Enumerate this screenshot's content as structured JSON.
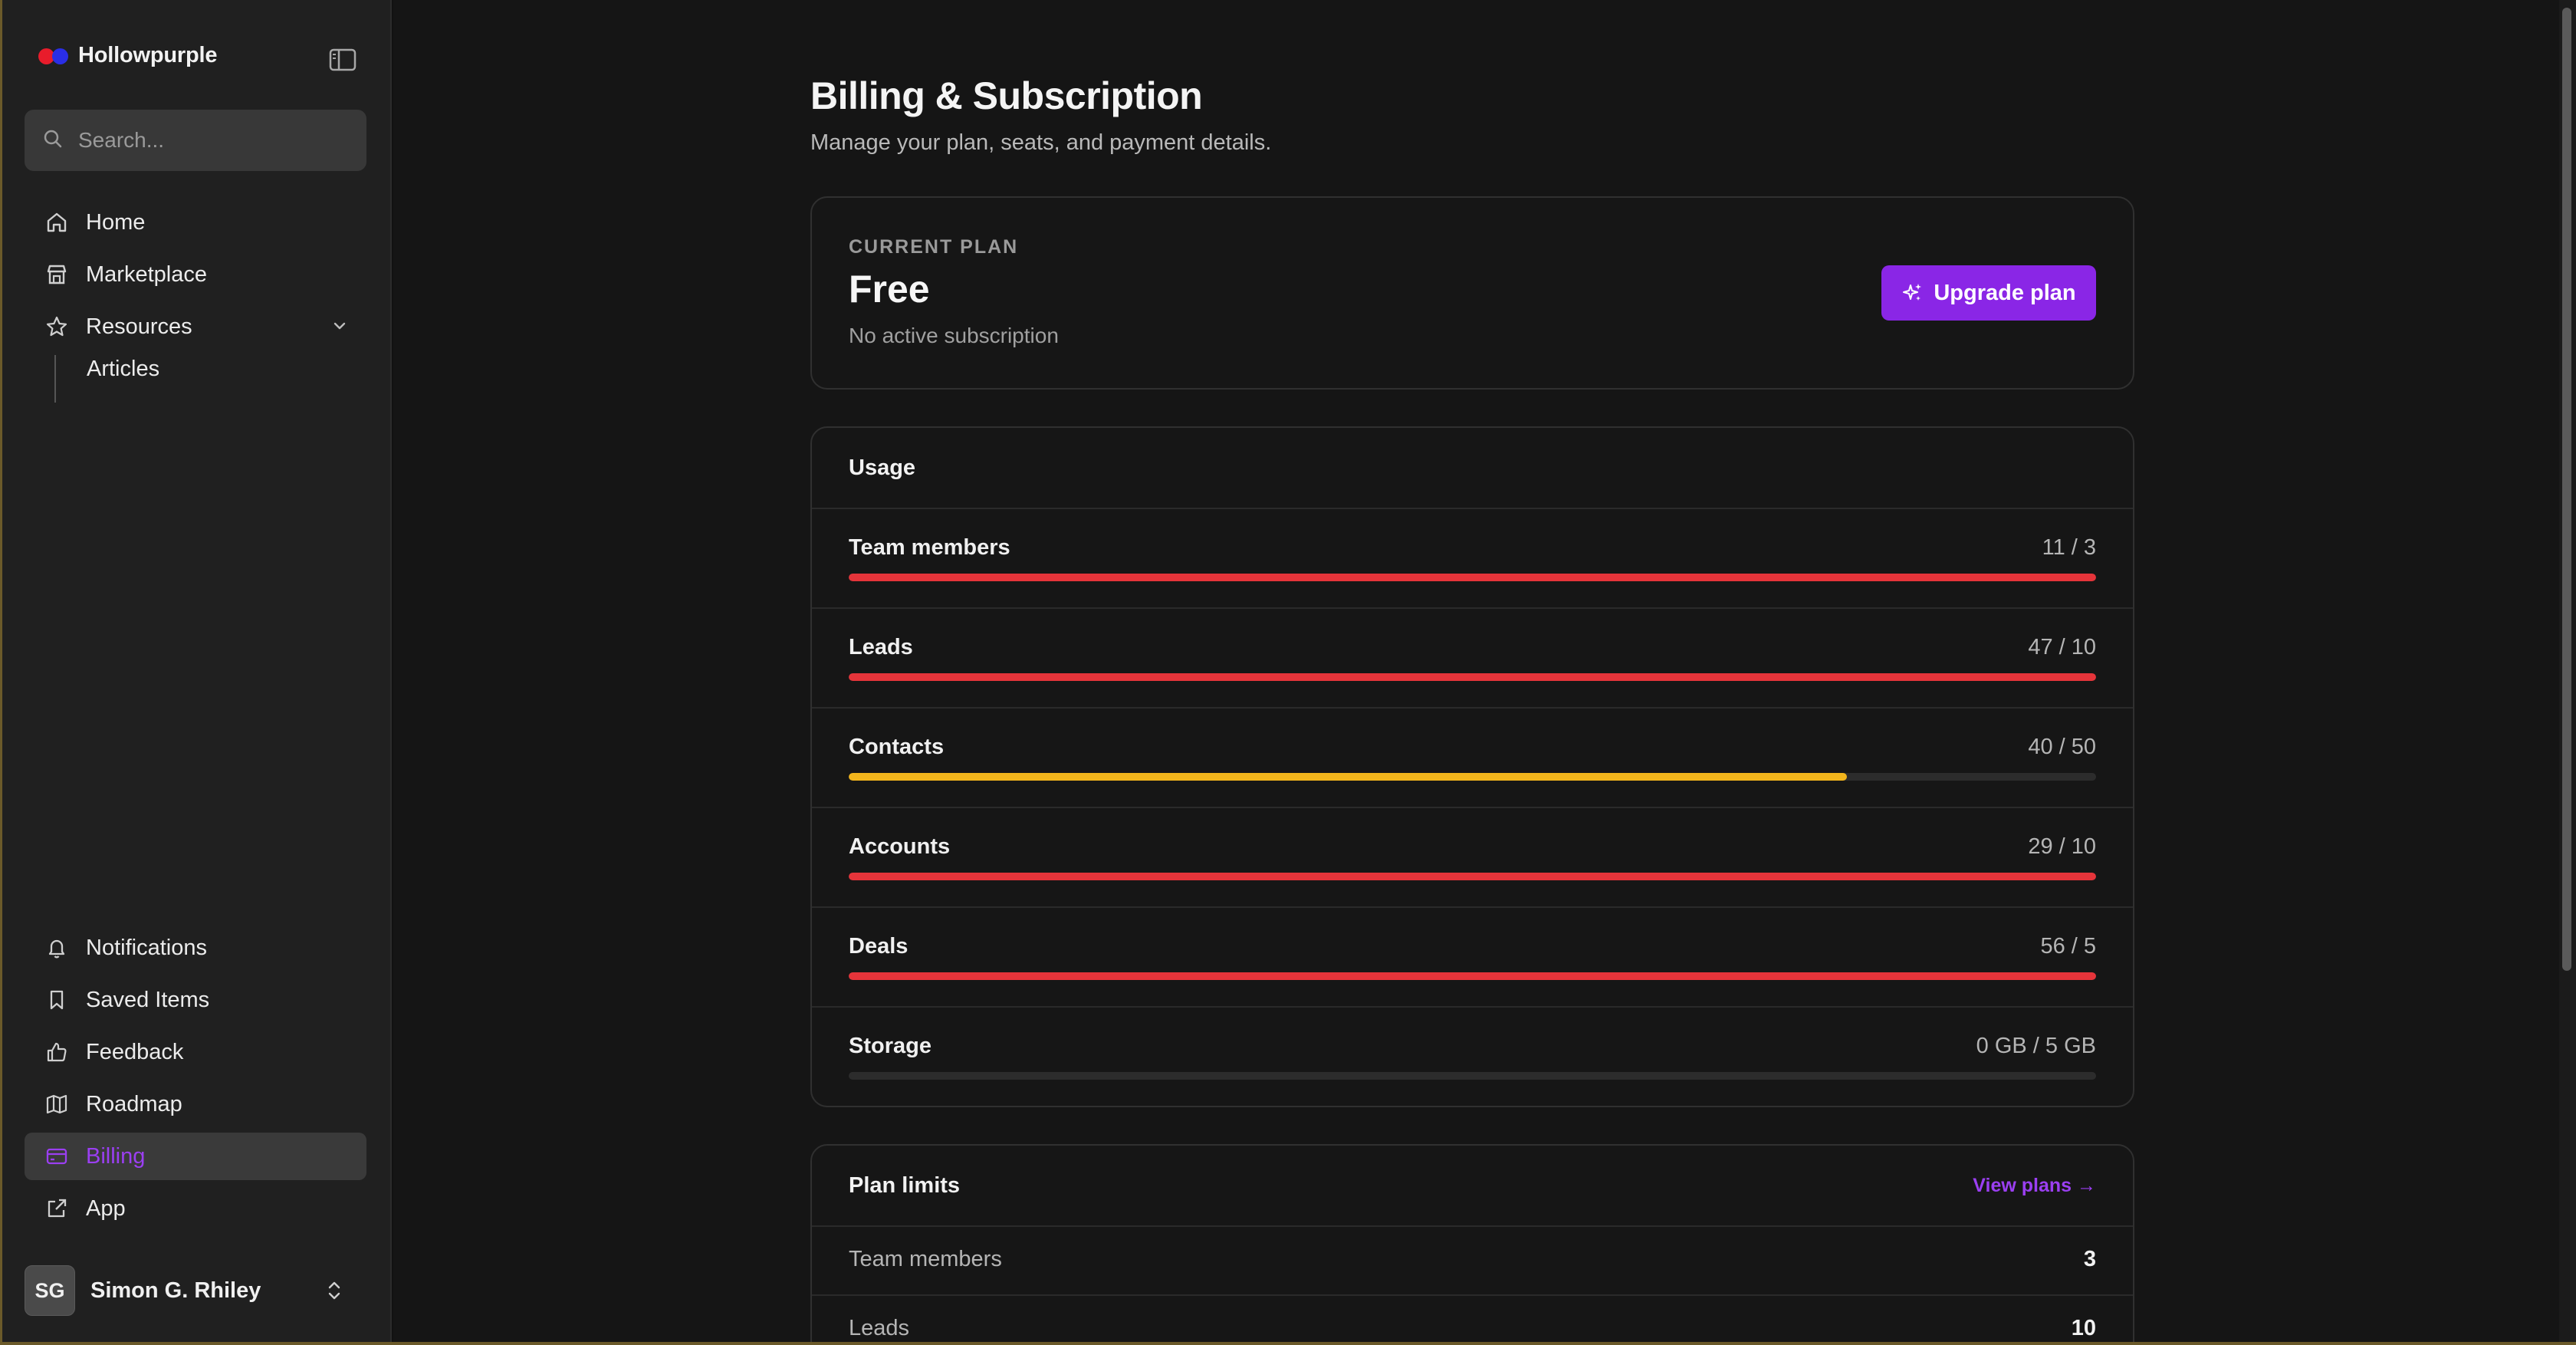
{
  "brand": {
    "name": "Hollowpurple"
  },
  "search": {
    "placeholder": "Search..."
  },
  "nav": {
    "home": "Home",
    "marketplace": "Marketplace",
    "resources": "Resources",
    "articles": "Articles",
    "notifications": "Notifications",
    "saved_items": "Saved Items",
    "feedback": "Feedback",
    "roadmap": "Roadmap",
    "billing": "Billing",
    "app": "App"
  },
  "user": {
    "initials": "SG",
    "name": "Simon G. Rhiley"
  },
  "page": {
    "title": "Billing & Subscription",
    "subtitle": "Manage your plan, seats, and payment details."
  },
  "plan": {
    "eyebrow": "CURRENT PLAN",
    "name": "Free",
    "status": "No active subscription",
    "upgrade_label": "Upgrade plan"
  },
  "usage": {
    "title": "Usage",
    "rows": [
      {
        "label": "Team members",
        "value": "11 / 3",
        "fraction": 1.0,
        "color": "#e5343a"
      },
      {
        "label": "Leads",
        "value": "47 / 10",
        "fraction": 1.0,
        "color": "#e5343a"
      },
      {
        "label": "Contacts",
        "value": "40 / 50",
        "fraction": 0.8,
        "color": "#f2b51c"
      },
      {
        "label": "Accounts",
        "value": "29 / 10",
        "fraction": 1.0,
        "color": "#e5343a"
      },
      {
        "label": "Deals",
        "value": "56 / 5",
        "fraction": 1.0,
        "color": "#e5343a"
      },
      {
        "label": "Storage",
        "value": "0 GB  / 5 GB",
        "fraction": 0.0,
        "color": "#e5343a"
      }
    ]
  },
  "limits": {
    "title": "Plan limits",
    "view_plans": "View plans →",
    "rows": [
      {
        "label": "Team members",
        "value": "3"
      },
      {
        "label": "Leads",
        "value": "10"
      }
    ]
  },
  "colors": {
    "accent": "#8a26e6",
    "accent_text": "#9b3ff2",
    "danger": "#e5343a",
    "warning": "#f2b51c"
  }
}
